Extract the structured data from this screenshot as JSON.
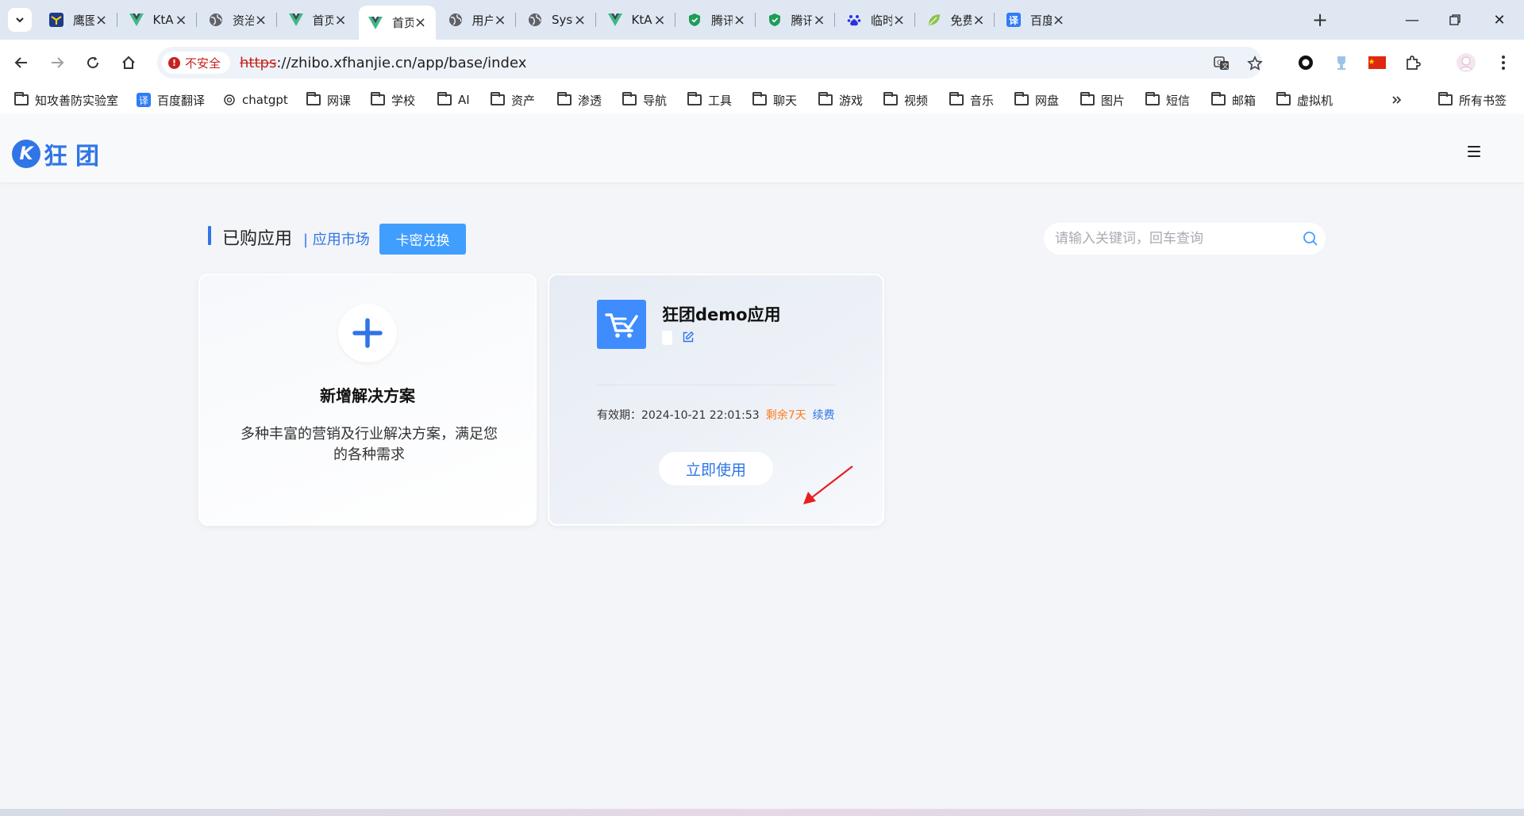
{
  "browser": {
    "tabs": [
      {
        "title": "鹰图平",
        "icon": "hunter-icon",
        "active": false
      },
      {
        "title": "KtAd",
        "icon": "vue-icon",
        "active": false
      },
      {
        "title": "资治通",
        "icon": "globe-icon",
        "active": false
      },
      {
        "title": "首页",
        "icon": "vue-icon",
        "active": false
      },
      {
        "title": "首页",
        "icon": "vue-icon",
        "active": true
      },
      {
        "title": "用户/",
        "icon": "globe-icon",
        "active": false
      },
      {
        "title": "Syste",
        "icon": "globe-icon",
        "active": false
      },
      {
        "title": "KtAd",
        "icon": "vue-icon",
        "active": false
      },
      {
        "title": "腾讯",
        "icon": "shield-icon",
        "active": false
      },
      {
        "title": "腾讯",
        "icon": "shield-icon",
        "active": false
      },
      {
        "title": "临时",
        "icon": "baidu-icon",
        "active": false
      },
      {
        "title": "免费",
        "icon": "leaf-icon",
        "active": false
      },
      {
        "title": "百度",
        "icon": "translate-icon",
        "active": false
      }
    ],
    "address": {
      "security_label": "不安全",
      "scheme": "https",
      "rest": "://zhibo.xfhanjie.cn/app/base/index"
    },
    "bookmarks": [
      {
        "label": "知攻善防实验室",
        "icon": "folder-icon"
      },
      {
        "label": "百度翻译",
        "icon": "translate-icon"
      },
      {
        "label": "chatgpt",
        "icon": "openai-icon"
      },
      {
        "label": "网课",
        "icon": "folder-icon"
      },
      {
        "label": "学校",
        "icon": "folder-icon"
      },
      {
        "label": "AI",
        "icon": "folder-icon"
      },
      {
        "label": "资产",
        "icon": "folder-icon"
      },
      {
        "label": "渗透",
        "icon": "folder-icon"
      },
      {
        "label": "导航",
        "icon": "folder-icon"
      },
      {
        "label": "工具",
        "icon": "folder-icon"
      },
      {
        "label": "聊天",
        "icon": "folder-icon"
      },
      {
        "label": "游戏",
        "icon": "folder-icon"
      },
      {
        "label": "视频",
        "icon": "folder-icon"
      },
      {
        "label": "音乐",
        "icon": "folder-icon"
      },
      {
        "label": "网盘",
        "icon": "folder-icon"
      },
      {
        "label": "图片",
        "icon": "folder-icon"
      },
      {
        "label": "短信",
        "icon": "folder-icon"
      },
      {
        "label": "邮箱",
        "icon": "folder-icon"
      },
      {
        "label": "虚拟机",
        "icon": "folder-icon"
      }
    ],
    "all_bookmarks_label": "所有书签"
  },
  "site": {
    "logo_text": "狂团",
    "brand_color": "#2f75e6"
  },
  "main": {
    "section_title": "已购应用",
    "market_link": "| 应用市场",
    "redeem_button": "卡密兑换",
    "search_placeholder": "请输入关键词，回车查询",
    "add_card": {
      "title": "新增解决方案",
      "desc": "多种丰富的营销及行业解决方案，满足您的各种需求"
    },
    "app_card": {
      "name": "狂团demo应用",
      "expiry_label": "有效期：",
      "expiry_value": "2024-10-21 22:01:53",
      "remaining": "剩余7天",
      "renew": "续费",
      "use_button": "立即使用"
    }
  },
  "colors": {
    "accent": "#409eff",
    "warning": "#ff7a1a",
    "insecure": "#c5221f"
  }
}
